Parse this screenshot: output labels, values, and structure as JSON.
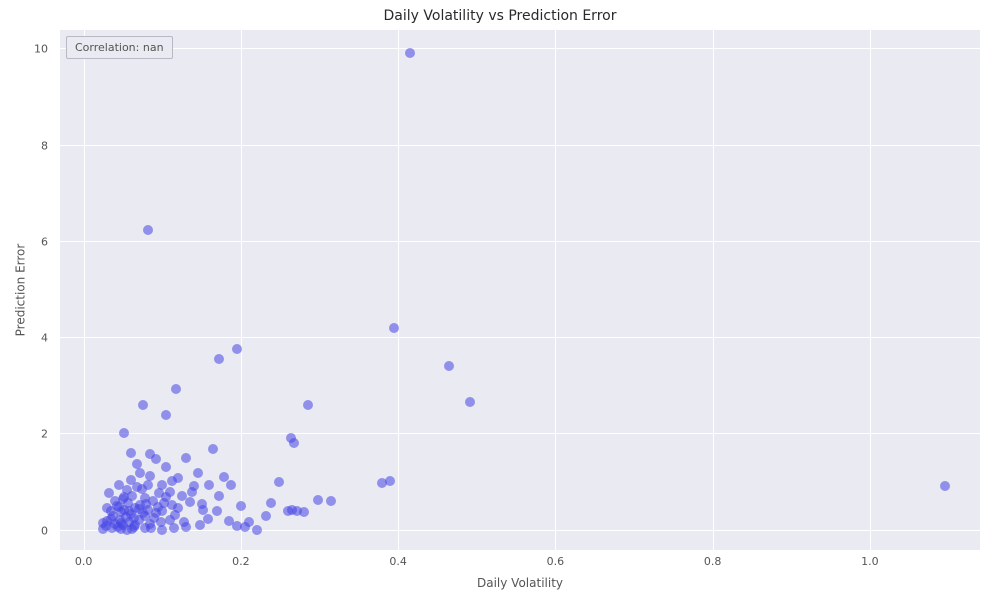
{
  "chart_data": {
    "type": "scatter",
    "title": "Daily Volatility vs Prediction Error",
    "xlabel": "Daily Volatility",
    "ylabel": "Prediction Error",
    "xlim": [
      -0.03,
      1.14
    ],
    "ylim": [
      -0.4,
      10.4
    ],
    "xticks": [
      0.0,
      0.2,
      0.4,
      0.6,
      0.8,
      1.0
    ],
    "yticks": [
      0,
      2,
      4,
      6,
      8,
      10
    ],
    "annotation": "Correlation: nan",
    "dot_color": "#4545e6",
    "dot_opacity": 0.55,
    "dot_radius_px": 5,
    "points": [
      [
        1.095,
        0.92
      ],
      [
        0.415,
        9.92
      ],
      [
        0.082,
        6.24
      ],
      [
        0.395,
        4.22
      ],
      [
        0.465,
        3.42
      ],
      [
        0.492,
        2.68
      ],
      [
        0.285,
        2.62
      ],
      [
        0.172,
        3.56
      ],
      [
        0.195,
        3.78
      ],
      [
        0.118,
        2.94
      ],
      [
        0.105,
        2.4
      ],
      [
        0.075,
        2.62
      ],
      [
        0.052,
        2.04
      ],
      [
        0.06,
        1.62
      ],
      [
        0.268,
        1.82
      ],
      [
        0.264,
        1.92
      ],
      [
        0.298,
        0.64
      ],
      [
        0.28,
        0.38
      ],
      [
        0.272,
        0.42
      ],
      [
        0.26,
        0.4
      ],
      [
        0.265,
        0.44
      ],
      [
        0.315,
        0.62
      ],
      [
        0.39,
        1.04
      ],
      [
        0.38,
        1.0
      ],
      [
        0.248,
        1.02
      ],
      [
        0.238,
        0.58
      ],
      [
        0.22,
        0.02
      ],
      [
        0.205,
        0.08
      ],
      [
        0.232,
        0.3
      ],
      [
        0.195,
        0.1
      ],
      [
        0.185,
        0.2
      ],
      [
        0.188,
        0.94
      ],
      [
        0.178,
        1.12
      ],
      [
        0.172,
        0.72
      ],
      [
        0.165,
        1.7
      ],
      [
        0.152,
        0.44
      ],
      [
        0.158,
        0.24
      ],
      [
        0.145,
        1.2
      ],
      [
        0.14,
        0.92
      ],
      [
        0.135,
        0.6
      ],
      [
        0.13,
        1.52
      ],
      [
        0.128,
        0.18
      ],
      [
        0.138,
        0.8
      ],
      [
        0.148,
        0.12
      ],
      [
        0.12,
        1.1
      ],
      [
        0.12,
        0.48
      ],
      [
        0.116,
        0.32
      ],
      [
        0.11,
        0.22
      ],
      [
        0.112,
        1.04
      ],
      [
        0.105,
        1.32
      ],
      [
        0.102,
        0.58
      ],
      [
        0.1,
        0.02
      ],
      [
        0.1,
        0.4
      ],
      [
        0.096,
        0.78
      ],
      [
        0.092,
        1.48
      ],
      [
        0.09,
        0.26
      ],
      [
        0.088,
        0.62
      ],
      [
        0.085,
        1.6
      ],
      [
        0.085,
        0.14
      ],
      [
        0.082,
        0.94
      ],
      [
        0.082,
        0.44
      ],
      [
        0.078,
        0.06
      ],
      [
        0.078,
        0.68
      ],
      [
        0.076,
        0.36
      ],
      [
        0.072,
        0.54
      ],
      [
        0.072,
        1.2
      ],
      [
        0.07,
        0.22
      ],
      [
        0.068,
        0.9
      ],
      [
        0.066,
        0.12
      ],
      [
        0.066,
        0.48
      ],
      [
        0.064,
        0.08
      ],
      [
        0.062,
        0.72
      ],
      [
        0.06,
        0.34
      ],
      [
        0.06,
        1.06
      ],
      [
        0.058,
        0.18
      ],
      [
        0.056,
        0.58
      ],
      [
        0.055,
        0.02
      ],
      [
        0.054,
        0.28
      ],
      [
        0.052,
        0.44
      ],
      [
        0.05,
        0.12
      ],
      [
        0.05,
        0.66
      ],
      [
        0.048,
        0.04
      ],
      [
        0.048,
        0.38
      ],
      [
        0.046,
        0.22
      ],
      [
        0.044,
        0.08
      ],
      [
        0.042,
        0.52
      ],
      [
        0.04,
        0.14
      ],
      [
        0.038,
        0.3
      ],
      [
        0.036,
        0.06
      ],
      [
        0.035,
        0.42
      ],
      [
        0.028,
        0.1
      ],
      [
        0.032,
        0.78
      ],
      [
        0.03,
        0.2
      ],
      [
        0.025,
        0.04
      ],
      [
        0.045,
        0.96
      ],
      [
        0.04,
        0.62
      ],
      [
        0.055,
        0.84
      ],
      [
        0.068,
        1.38
      ],
      [
        0.11,
        0.8
      ],
      [
        0.115,
        0.06
      ],
      [
        0.1,
        0.94
      ],
      [
        0.094,
        0.5
      ],
      [
        0.15,
        0.56
      ],
      [
        0.16,
        0.94
      ],
      [
        0.17,
        0.4
      ],
      [
        0.2,
        0.52
      ],
      [
        0.21,
        0.18
      ],
      [
        0.084,
        1.14
      ],
      [
        0.062,
        0.04
      ],
      [
        0.07,
        0.46
      ],
      [
        0.078,
        0.3
      ],
      [
        0.086,
        0.06
      ],
      [
        0.092,
        0.36
      ],
      [
        0.052,
        0.7
      ],
      [
        0.045,
        0.5
      ],
      [
        0.035,
        0.24
      ],
      [
        0.025,
        0.16
      ],
      [
        0.03,
        0.48
      ],
      [
        0.047,
        0.16
      ],
      [
        0.058,
        0.42
      ],
      [
        0.064,
        0.26
      ],
      [
        0.074,
        0.86
      ],
      [
        0.08,
        0.56
      ],
      [
        0.098,
        0.18
      ],
      [
        0.105,
        0.7
      ],
      [
        0.125,
        0.72
      ],
      [
        0.13,
        0.08
      ],
      [
        0.112,
        0.54
      ]
    ]
  }
}
